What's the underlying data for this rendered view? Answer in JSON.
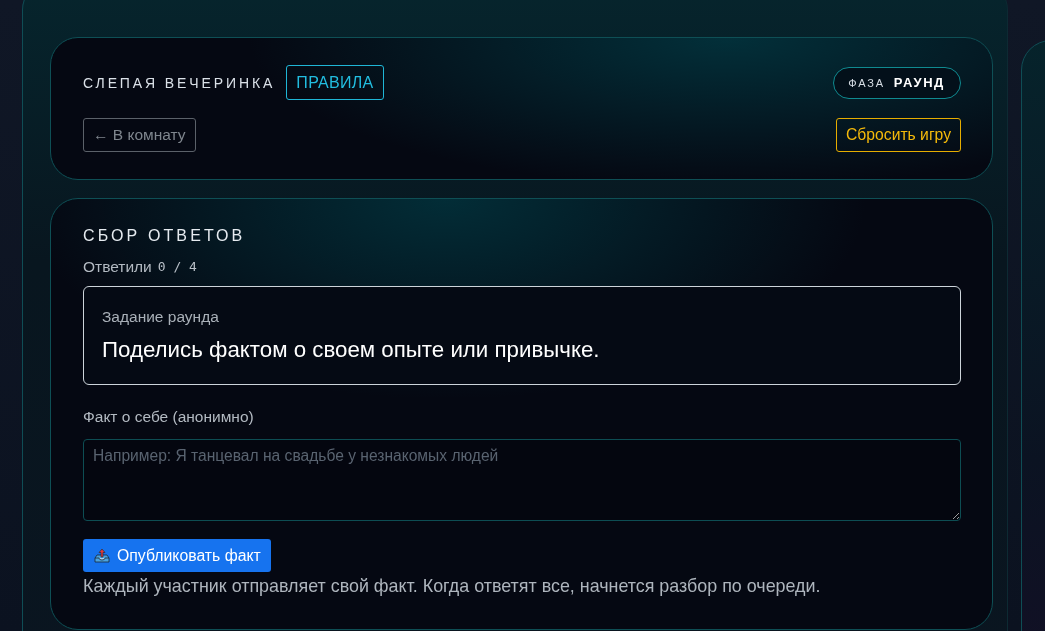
{
  "header": {
    "title": "СЛЕПАЯ ВЕЧЕРИНКА",
    "rules_button": "ПРАВИЛА",
    "phase": {
      "label": "ФАЗА",
      "value": "РАУНД"
    },
    "back_button": "← В комнату",
    "reset_button": "Сбросить игру"
  },
  "collect": {
    "title": "СБОР ОТВЕТОВ",
    "answered_label": "Ответили",
    "answered_count": "0 / 4",
    "task": {
      "label": "Задание раунда",
      "text": "Поделись фактом о своем опыте или привычке."
    },
    "fact_field": {
      "label": "Факт о себе (анонимно)",
      "placeholder": "Например: Я танцевал на свадьбе у незнакомых людей"
    },
    "publish_button": "Опубликовать факт",
    "hint": "Каждый участник отправляет свой факт. Когда ответят все, начнется разбор по очереди."
  }
}
